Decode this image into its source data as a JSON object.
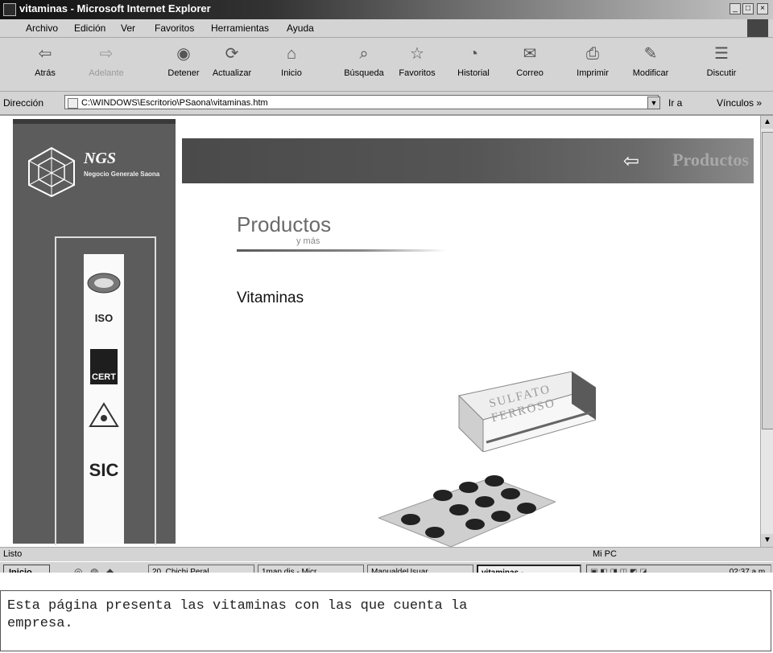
{
  "window": {
    "title": "vitaminas - Microsoft Internet Explorer",
    "controls": [
      "_",
      "□",
      "×"
    ]
  },
  "menu": {
    "items": [
      "Archivo",
      "Edición",
      "Ver",
      "Favoritos",
      "Herramientas",
      "Ayuda"
    ]
  },
  "toolbar": {
    "buttons": [
      {
        "label": "Atrás",
        "icon": "back-arrow-icon"
      },
      {
        "label": "Adelante",
        "icon": "forward-arrow-icon"
      },
      {
        "label": "Detener",
        "icon": "stop-icon"
      },
      {
        "label": "Actualizar",
        "icon": "refresh-icon"
      },
      {
        "label": "Inicio",
        "icon": "home-icon"
      },
      {
        "label": "Búsqueda",
        "icon": "search-icon"
      },
      {
        "label": "Favoritos",
        "icon": "favorites-icon"
      },
      {
        "label": "Historial",
        "icon": "history-icon"
      },
      {
        "label": "Correo",
        "icon": "mail-icon"
      },
      {
        "label": "Imprimir",
        "icon": "print-icon"
      },
      {
        "label": "Modificar",
        "icon": "edit-icon"
      },
      {
        "label": "Discutir",
        "icon": "discuss-icon"
      }
    ]
  },
  "address": {
    "label": "Dirección",
    "url": "C:\\WINDOWS\\Escritorio\\PSaona\\vitaminas.htm",
    "go": "Ir a",
    "links": "Vínculos »"
  },
  "page": {
    "logo_name": "NGS",
    "logo_sub": "Negocio Generale Saona",
    "banner_text": "Productos",
    "heading": "Productos",
    "heading_sub": "y más",
    "section_title": "Vitaminas",
    "product_label": "SULFATO FERROSO",
    "certifications": [
      "ISO",
      "CERT",
      "SIC"
    ]
  },
  "status": {
    "text": "Listo",
    "zone": "Mi PC"
  },
  "taskbar": {
    "start": "Inicio",
    "tasks": [
      "20. Chichi Peral...",
      "1man dis - Micr...",
      "ManualdeUsuar...",
      "vitaminas - ..."
    ],
    "clock": "02:37 a.m."
  },
  "caption": {
    "text": "Esta página presenta las vitaminas con las que cuenta la empresa."
  }
}
